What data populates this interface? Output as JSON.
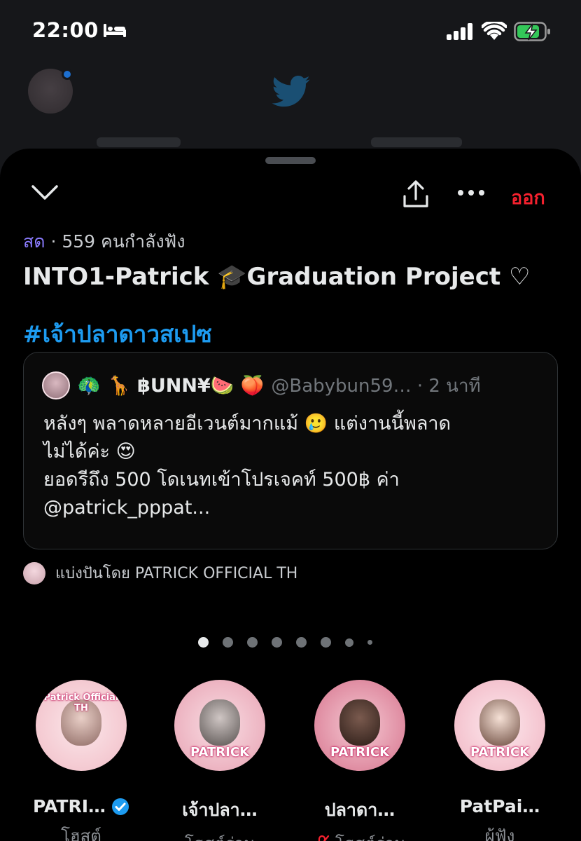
{
  "status_bar": {
    "time": "22:00"
  },
  "header": {
    "leave_label": "ออก"
  },
  "space": {
    "live_label": "สด",
    "listeners": "· 559 คนกำลังฟัง",
    "title": "INTO1-Patrick 🎓Graduation Project ♡",
    "hashtag": "#เจ้าปลาดาวสเปซ"
  },
  "pinned_tweet": {
    "name": "🦚 🦒 ฿UNN¥🍉 🍑",
    "handle": "@Babybun59… · 2 นาที",
    "text": "หลังๆ พลาดหลายอีเวนต์มากแม้ 🥲  แต่งานนี้พลาด\nไม่ได้ค่ะ 😍\nยอดรีถึง 500 โดเนทเข้าโปรเจคท์ 500฿ ค่า\n@patrick_pppat..."
  },
  "shared_by": "แบ่งปันโดย PATRICK OFFICIAL TH",
  "pagination": {
    "total": 8,
    "active": 0
  },
  "participants": [
    {
      "name": "PATRI…",
      "role": "โฮสต์",
      "avatar_label": "Patrick Official TH",
      "verified": true,
      "muted": false,
      "color": "#f6d5d9"
    },
    {
      "name": "เจ้าปลา…",
      "role": "โฮสต์ร่วม",
      "avatar_label": "PATRICK",
      "verified": false,
      "muted": false,
      "color": "#f2c2cc"
    },
    {
      "name": "ปลาดา…",
      "role": "โฮสต์ร่วม",
      "avatar_label": "PATRICK",
      "verified": false,
      "muted": true,
      "color": "#e9a6b5"
    },
    {
      "name": "PatPai…",
      "role": "ผู้ฟัง",
      "avatar_label": "PATRICK",
      "verified": false,
      "muted": false,
      "color": "#f4c7d0"
    }
  ],
  "colors": {
    "accent": "#1d9bf0",
    "live": "#8b7cff",
    "leave": "#f4212e"
  }
}
